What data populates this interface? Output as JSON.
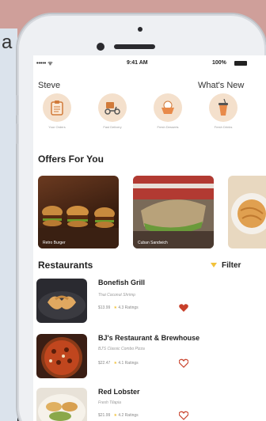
{
  "background": {
    "left_fragment": "a"
  },
  "status": {
    "carrier": "•••••  ᯤ",
    "time": "9:41 AM",
    "battery": "100%"
  },
  "header": {
    "greeting": "Steve",
    "whats_new": "What's New"
  },
  "categories": [
    {
      "label": "Your Orders",
      "icon": "clipboard-icon"
    },
    {
      "label": "Fast Delivery",
      "icon": "delivery-scooter-icon"
    },
    {
      "label": "Fresh Desserts",
      "icon": "dessert-bowl-icon"
    },
    {
      "label": "Fresh Drinks",
      "icon": "drink-cup-icon"
    }
  ],
  "offers": {
    "title": "Offers For You",
    "items": [
      {
        "label": "Retro Burger"
      },
      {
        "label": "Cuban Sandwich"
      },
      {
        "label": ""
      }
    ]
  },
  "restaurants": {
    "title": "Restaurants",
    "filter_label": "Filter",
    "items": [
      {
        "name": "Bonefish Grill",
        "dish": "Thai Coconut Shrimp",
        "price": "$13.99",
        "rating": "4.3 Ratings",
        "favorited": true
      },
      {
        "name": "BJ's Restaurant & Brewhouse",
        "dish": "BJ'S Classic Combo Pizza",
        "price": "$22.47",
        "rating": "4.1 Ratings",
        "favorited": false
      },
      {
        "name": "Red Lobster",
        "dish": "Fresh Tilapia",
        "price": "$21.99",
        "rating": "4.2 Ratings",
        "favorited": false
      }
    ]
  },
  "colors": {
    "accent": "#e0783a",
    "heart_filled": "#c8402a",
    "heart_outline": "#c8402a",
    "star": "#f2c23a"
  }
}
